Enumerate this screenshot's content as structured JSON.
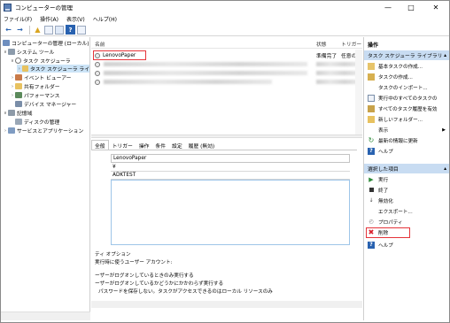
{
  "window": {
    "title": "コンピューターの管理"
  },
  "menu": [
    "ファイル(F)",
    "操作(A)",
    "表示(V)",
    "ヘルプ(H)"
  ],
  "tree": {
    "root": "コンピューターの管理 (ローカル)",
    "system_tools": "システム ツール",
    "task_scheduler": "タスク スケジューラ",
    "task_library": "タスク スケジューラ ライ",
    "event_viewer": "イベント ビューアー",
    "shared_folders": "共有フォルダー",
    "performance": "パフォーマンス",
    "device_manager": "デバイス マネージャー",
    "storage": "記憶域",
    "disk_mgmt": "ディスクの管理",
    "services": "サービスとアプリケーション"
  },
  "list": {
    "col_name": "名前",
    "col_status": "状態",
    "col_trigger": "トリガー",
    "rows": [
      {
        "name": "LenovoPaper",
        "status": "準備完了",
        "trigger": "任意の"
      }
    ]
  },
  "details": {
    "tabs": [
      "全般",
      "トリガー",
      "操作",
      "条件",
      "設定",
      "履歴 (無効)"
    ],
    "name_value": "LenovoPaper",
    "location_value": "¥",
    "author_value": "ADKTEST",
    "security_options_label": "ティ オプション",
    "run_as_label": "実行時に使うユーザー アカウント:",
    "opt1": "ーザーがログオンしているときのみ実行する",
    "opt2": "ーザーがログオンしているかどうかにかかわらず実行する",
    "opt3": "パスワードを保存しない。タスクがアクセスできるのはローカル リソースのみ"
  },
  "actions": {
    "header": "操作",
    "section1": "タスク スケジューラ ライブラリ",
    "items1": [
      "基本タスクの作成...",
      "タスクの作成...",
      "タスクのインポート...",
      "実行中のすべてのタスクの",
      "すべてのタスク履歴を有効",
      "新しいフォルダー...",
      "表示",
      "最新の情報に更新",
      "ヘルプ"
    ],
    "section2": "選択した項目",
    "items2": [
      "実行",
      "終了",
      "無効化",
      "エクスポート...",
      "プロパティ",
      "削除",
      "ヘルプ"
    ]
  },
  "colors": {
    "highlight_red": "#e5343a",
    "action_header": "#c8dcf2",
    "tree_selected": "#cce4f7"
  }
}
